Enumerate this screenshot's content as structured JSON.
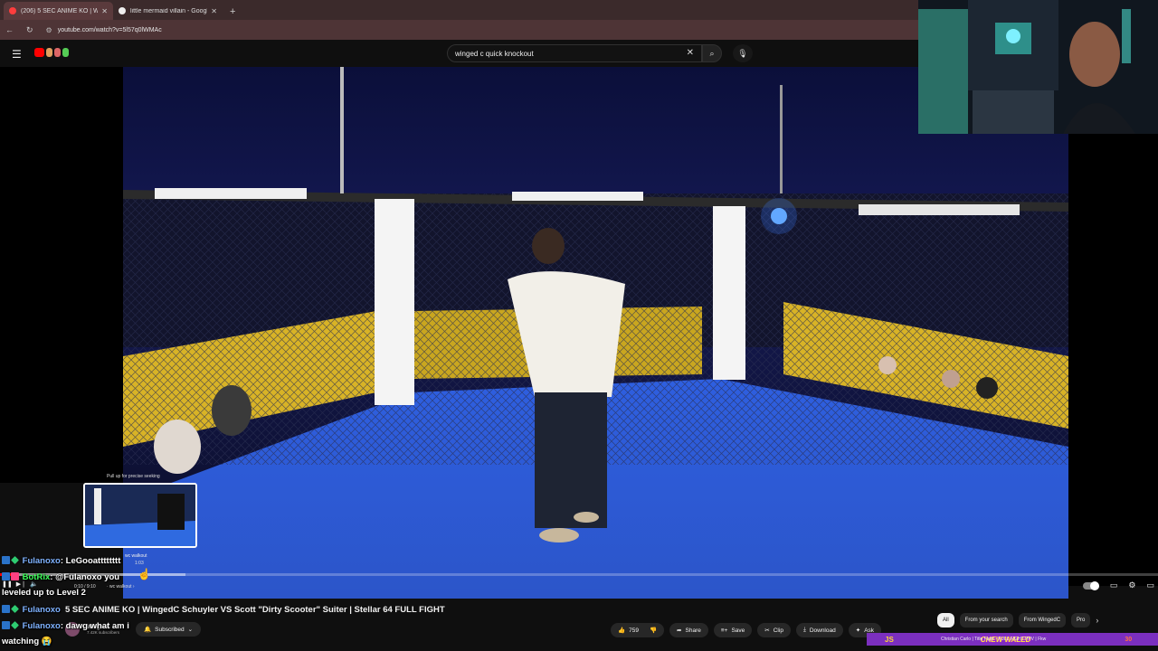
{
  "browser": {
    "tabs": [
      {
        "title": "(206) 5 SEC ANIME KO | W",
        "active": true,
        "favicon_color": "#ff3d3d"
      },
      {
        "title": "little mermaid villain - Google S",
        "active": false,
        "favicon_color": "#eeeeee"
      }
    ],
    "new_tab": "+",
    "url": "youtube.com/watch?v=5l57q0lWMAc"
  },
  "youtube": {
    "search_query": "winged c quick knockout",
    "video": {
      "title": "5 SEC ANIME KO | WingedC Schuyler VS Scott \"Dirty Scooter\" Suiter | Stellar 64 FULL FIGHT",
      "preview_tip": "Pull up for precise seeking",
      "preview_chapter": "wc walkout",
      "preview_time": "1:03",
      "timecode": "0:10 / 9:10",
      "chapter": "· wc walkout ›",
      "progress_played": 0.01,
      "progress_buffered": 0.16
    },
    "channel": {
      "name": "WingedC",
      "subscribers": "7.42K subscribers",
      "subscribe_label": "Subscribed"
    },
    "actions": {
      "likes": "759",
      "share": "Share",
      "save": "Save",
      "clip": "Clip",
      "download": "Download",
      "ask": "Ask"
    },
    "chips": [
      "All",
      "From your search",
      "From WingedC",
      "Pro"
    ],
    "sidebar_snippet": "Christian Carlo | Title Fight - FULL FIGHT PPV | Fkw"
  },
  "overlay_alert": {
    "text1": "JS",
    "text2": "CHEW WALED",
    "text3": "30"
  },
  "chat": [
    {
      "user": "Fulanoxo",
      "text": ": LeGooatttttttt"
    },
    {
      "user": "BotRix",
      "text": ": @Fulanoxo you"
    },
    {
      "user": "",
      "text": "leveled up to Level 2"
    },
    {
      "user": "Fulanoxo",
      "text": ""
    },
    {
      "user": "Fulanoxo",
      "text": ": dawg what am i"
    },
    {
      "user": "",
      "text": "watching 😭"
    }
  ]
}
